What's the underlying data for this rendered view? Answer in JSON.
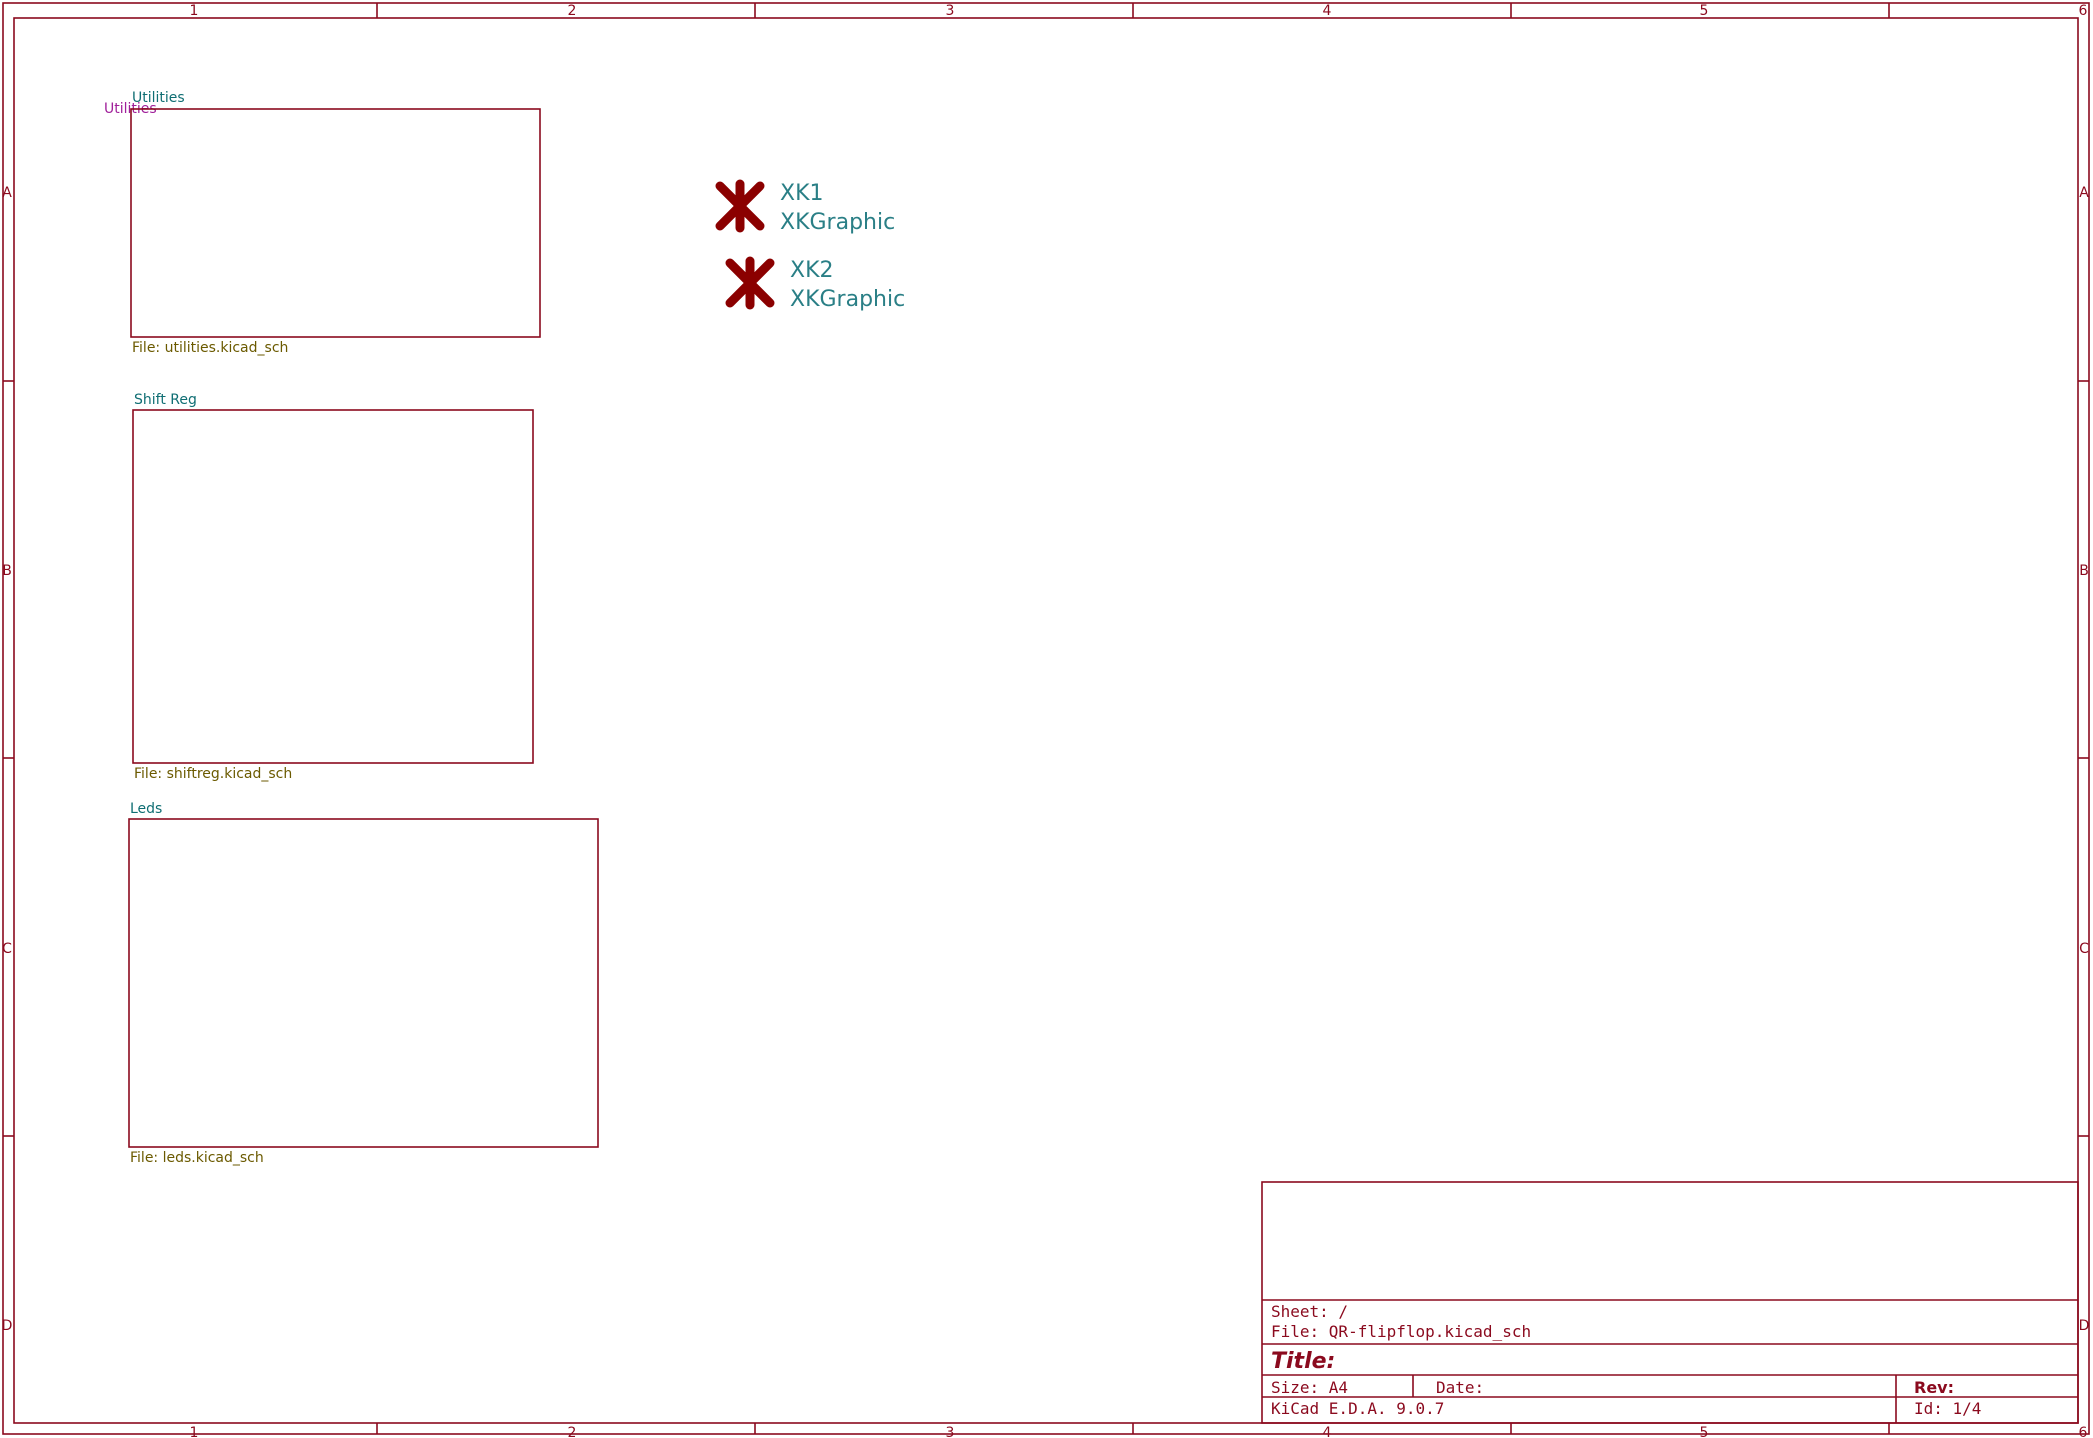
{
  "colors": {
    "frame": "#8b0a1e",
    "sheet_name": "#0f6e73",
    "sheet_file": "#6b5a00",
    "hier_label": "#a0209a",
    "symbol": "#8b0000",
    "reference": "#2a7f86"
  },
  "border": {
    "columns": [
      "1",
      "2",
      "3",
      "4",
      "5",
      "6"
    ],
    "rows": [
      "A",
      "B",
      "C",
      "D"
    ]
  },
  "hierarchical_label": "Utilities",
  "sheets": [
    {
      "name": "Utilities",
      "file": "File: utilities.kicad_sch"
    },
    {
      "name": "Shift Reg",
      "file": "File: shiftreg.kicad_sch"
    },
    {
      "name": "Leds",
      "file": "File: leds.kicad_sch"
    }
  ],
  "symbols": [
    {
      "reference": "XK1",
      "value": "XKGraphic",
      "icon": "asterisk-graphic-icon"
    },
    {
      "reference": "XK2",
      "value": "XKGraphic",
      "icon": "asterisk-graphic-icon"
    }
  ],
  "title_block": {
    "sheet": "Sheet: /",
    "file": "File: QR-flipflop.kicad_sch",
    "title": "Title:",
    "size": "Size: A4",
    "date": "Date:",
    "rev": "Rev:",
    "app": "KiCad E.D.A. 9.0.7",
    "id": "Id: 1/4"
  }
}
